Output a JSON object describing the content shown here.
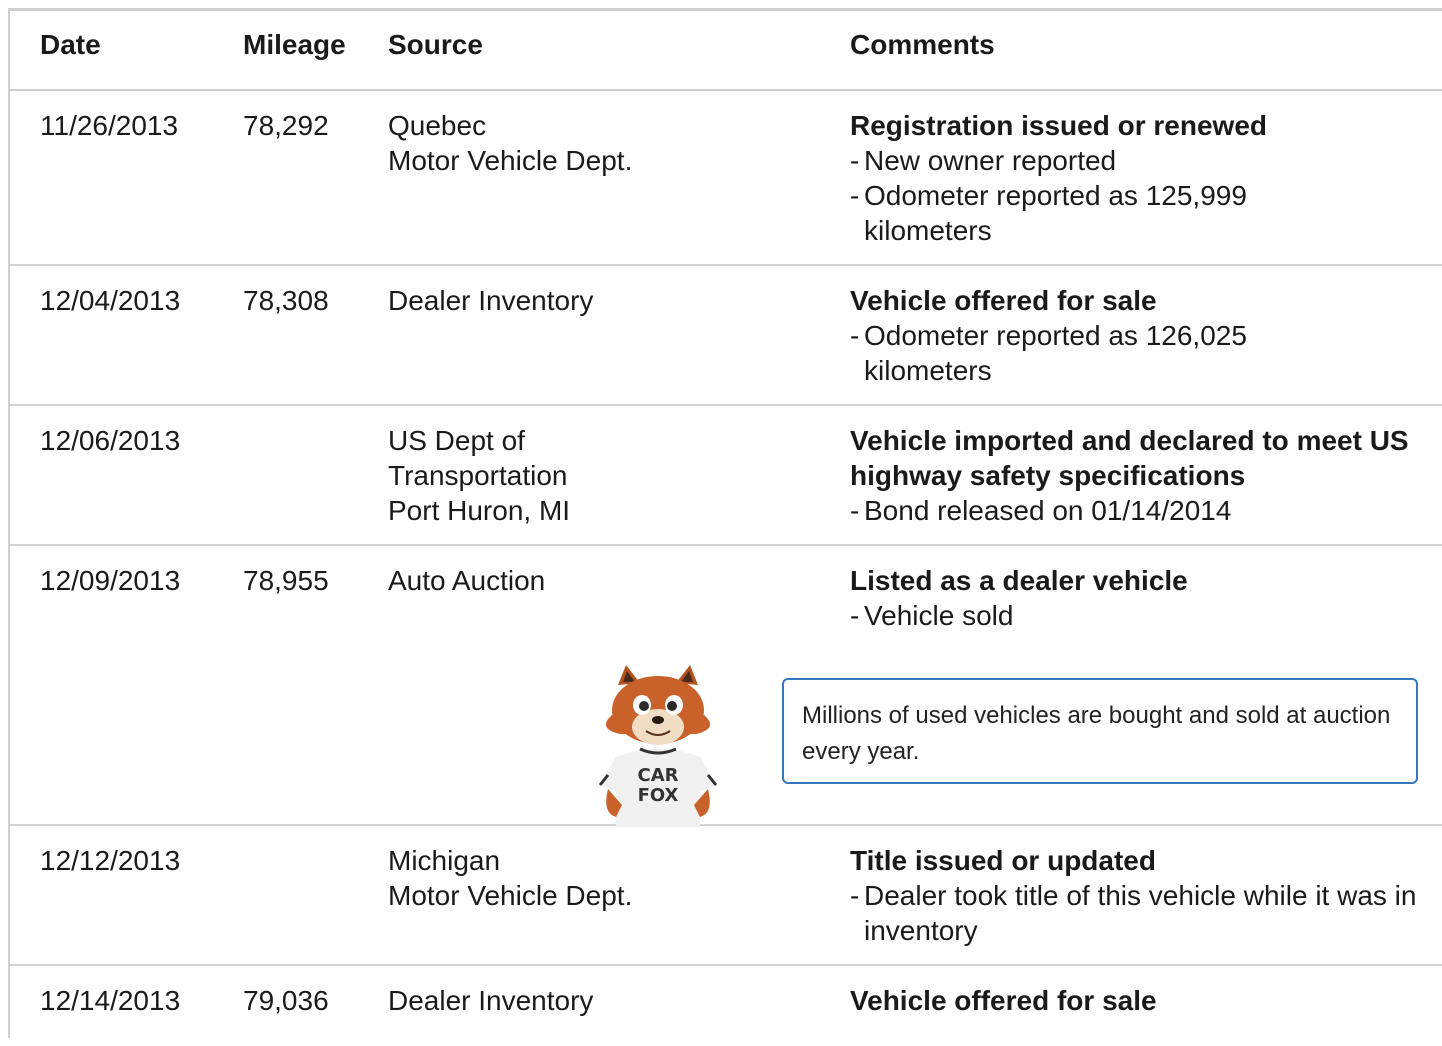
{
  "headers": {
    "date": "Date",
    "mileage": "Mileage",
    "source": "Source",
    "comments": "Comments"
  },
  "rows": [
    {
      "date": "11/26/2013",
      "mileage": "78,292",
      "source": [
        "Quebec",
        "Motor Vehicle Dept."
      ],
      "title": "Registration issued or renewed",
      "bullets": [
        "New owner reported",
        "Odometer reported as 125,999 kilometers"
      ]
    },
    {
      "date": "12/04/2013",
      "mileage": "78,308",
      "source": [
        "Dealer Inventory"
      ],
      "title": "Vehicle offered for sale",
      "bullets": [
        "Odometer reported as 126,025 kilometers"
      ]
    },
    {
      "date": "12/06/2013",
      "mileage": "",
      "source": [
        "US Dept of",
        "Transportation",
        "Port Huron, MI"
      ],
      "title": "Vehicle imported and declared to meet US highway safety specifications",
      "bullets": [
        "Bond released on 01/14/2014"
      ]
    },
    {
      "date": "12/09/2013",
      "mileage": "78,955",
      "source": [
        "Auto Auction"
      ],
      "title": "Listed as a dealer vehicle",
      "bullets": [
        "Vehicle sold"
      ]
    },
    {
      "date": "12/12/2013",
      "mileage": "",
      "source": [
        "Michigan",
        "Motor Vehicle Dept."
      ],
      "title": "Title issued or updated",
      "bullets": [
        "Dealer took title of this vehicle while it was in inventory"
      ]
    },
    {
      "date": "12/14/2013",
      "mileage": "79,036",
      "source": [
        "Dealer Inventory"
      ],
      "title": "Vehicle offered for sale",
      "bullets": []
    }
  ],
  "tip": {
    "text": "Millions of used vehicles are bought and sold at auction every year."
  },
  "fox": {
    "shirt_line1": "CAR",
    "shirt_line2": "FOX",
    "fur_color": "#c8612a",
    "shirt_color": "#f0f0f0"
  },
  "colors": {
    "tip_border": "#3777bc",
    "divider": "#d3d3d3"
  }
}
